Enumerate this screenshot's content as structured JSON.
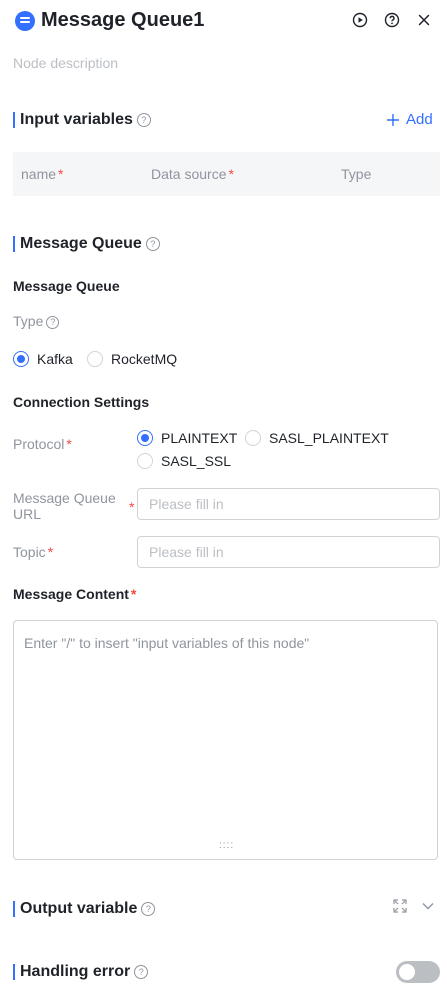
{
  "header": {
    "title": "Message Queue1",
    "node_icon": "message-queue-icon",
    "run_icon": "play-circle-icon",
    "help_icon": "question-circle-icon",
    "close_icon": "close-icon",
    "node_description_placeholder": "Node description"
  },
  "input_variables": {
    "title": "Input variables",
    "add_label": "Add",
    "columns": [
      "name",
      "Data source",
      "Type"
    ]
  },
  "message_queue_section": {
    "title": "Message Queue",
    "subheading": "Message Queue",
    "type_label": "Type",
    "type_options": [
      {
        "label": "Kafka",
        "checked": true
      },
      {
        "label": "RocketMQ",
        "checked": false
      }
    ],
    "connection_settings": "Connection Settings",
    "protocol_label": "Protocol",
    "protocol_options": [
      {
        "label": "PLAINTEXT",
        "checked": true
      },
      {
        "label": "SASL_PLAINTEXT",
        "checked": false
      },
      {
        "label": "SASL_SSL",
        "checked": false
      }
    ],
    "url_label_line1": "Message Queue",
    "url_label_line2": "URL",
    "url_placeholder": "Please fill in",
    "topic_label": "Topic",
    "topic_placeholder": "Please fill in",
    "content_label": "Message Content",
    "content_placeholder": "Enter \"/\" to insert \"input variables of this node\""
  },
  "output_variable": {
    "title": "Output variable",
    "expand_icon": "expand-icon",
    "chevron_icon": "chevron-down-icon"
  },
  "handling_error": {
    "title": "Handling error",
    "enabled": false
  },
  "colors": {
    "accent": "#3370ff",
    "required": "#f54a45",
    "muted": "#8f959e"
  }
}
